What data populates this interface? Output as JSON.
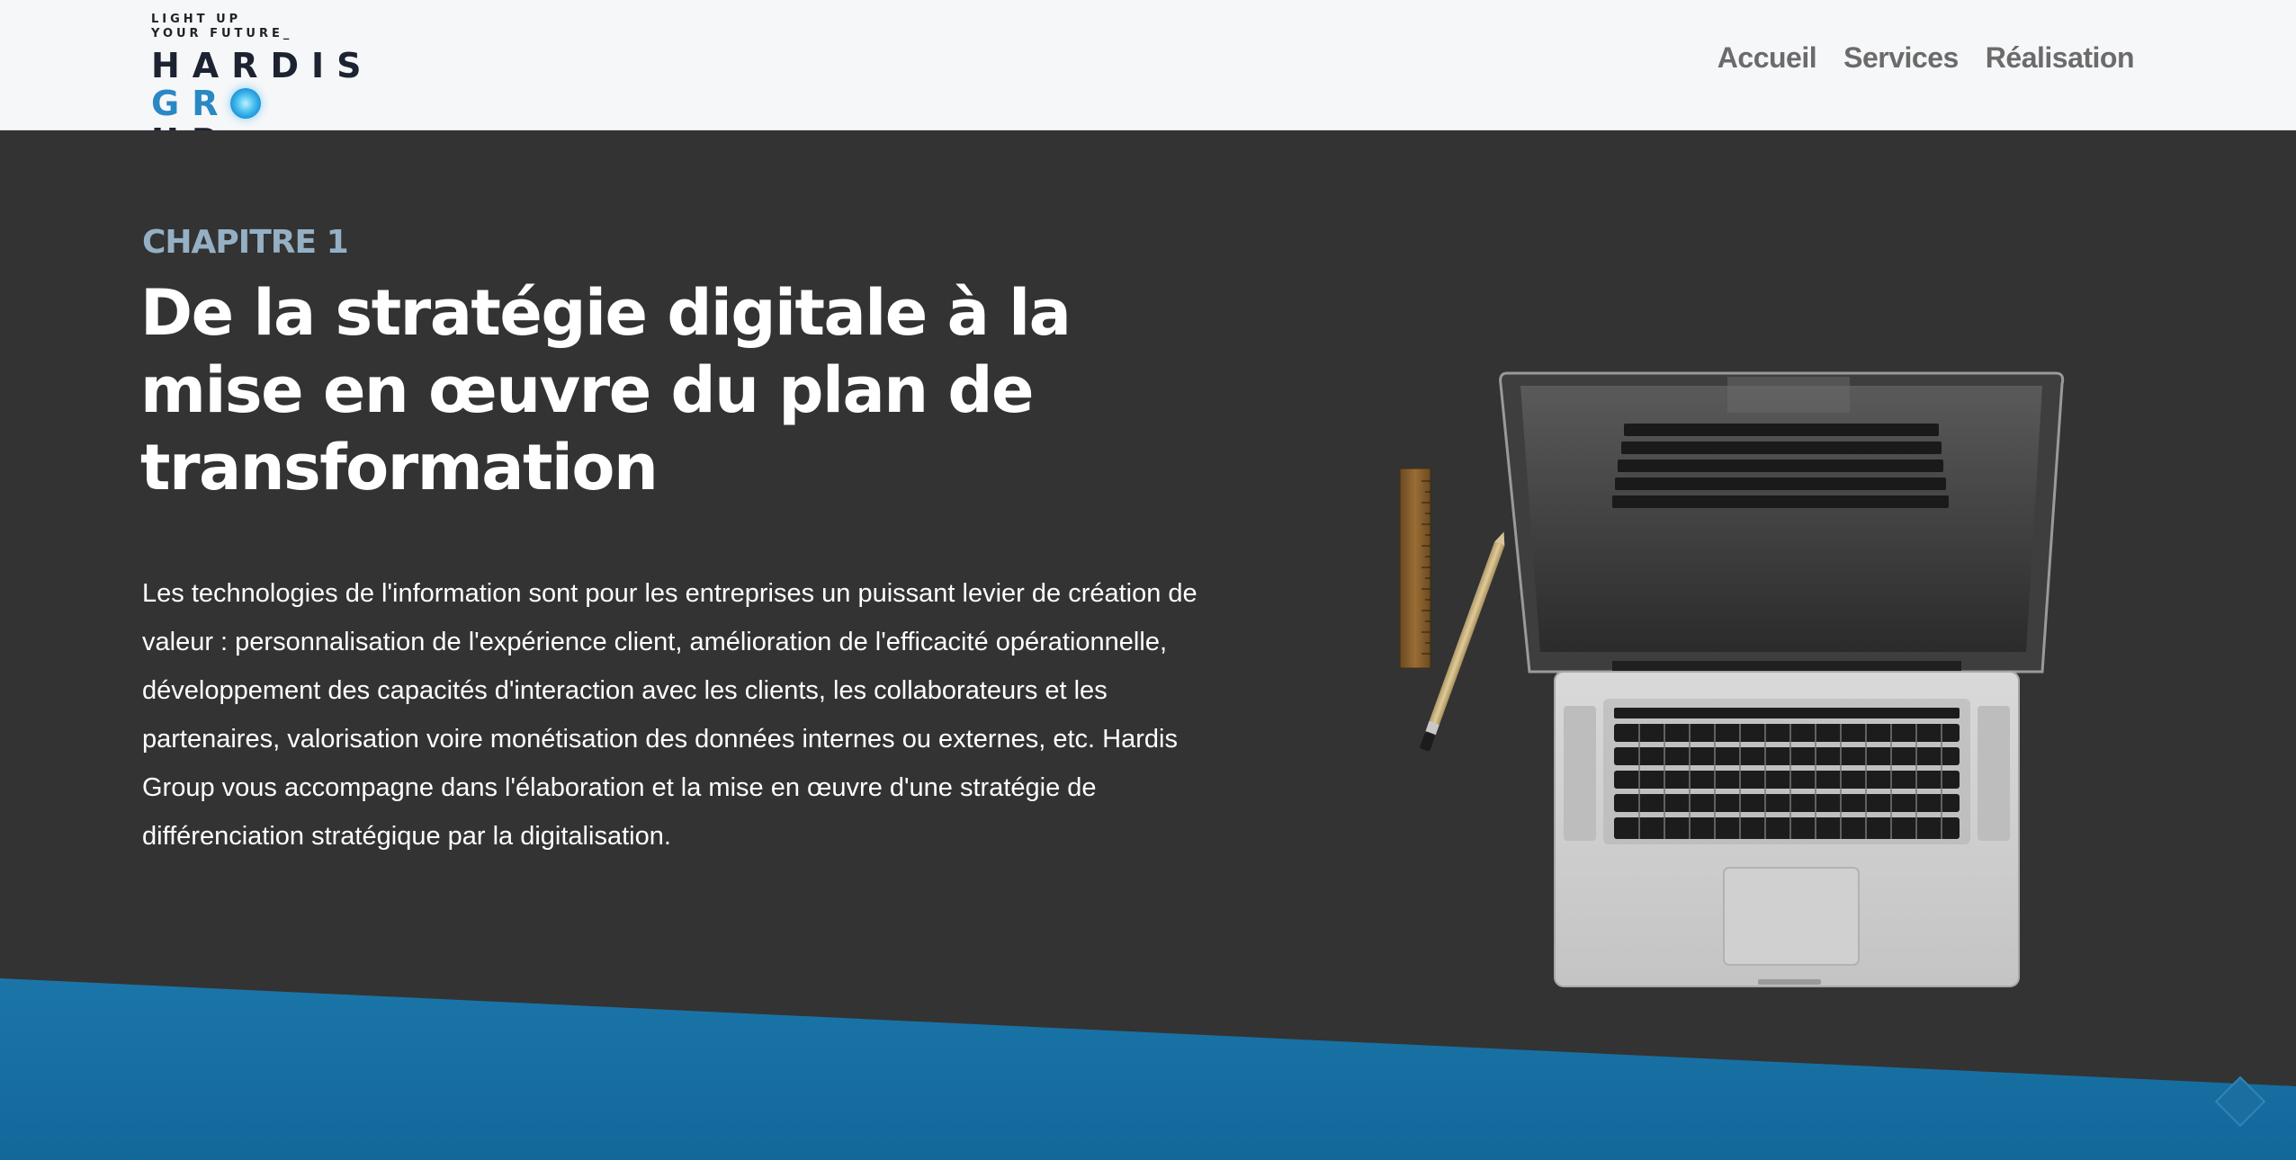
{
  "header": {
    "logo": {
      "tagline_line1": "LIGHT UP",
      "tagline_line2": "YOUR FUTURE_",
      "word1": "HARDIS",
      "word2_before": "GR",
      "word2_after": "UP"
    },
    "nav": [
      {
        "label": "Accueil"
      },
      {
        "label": "Services"
      },
      {
        "label": "Réalisation"
      }
    ]
  },
  "hero": {
    "chapter": "CHAPITRE 1",
    "title": "De la stratégie digitale à la mise en œuvre du plan de transformation",
    "body": "Les technologies de l'information sont pour les entreprises un puissant levier de création de valeur : personnalisation de l'expérience client, amélioration de l'efficacité opérationnelle, développement des capacités d'interaction avec les clients, les collaborateurs et les partenaires, valorisation voire monétisation des données internes ou externes, etc. Hardis Group vous accompagne dans l'élaboration et la mise en œuvre d'une stratégie de différenciation stratégique par la digitalisation."
  },
  "colors": {
    "header_bg": "#f6f7f9",
    "hero_bg": "#333333",
    "chapter": "#95b0c4",
    "band_blue": "#1a6fa0",
    "logo_blue": "#2a88c4"
  },
  "icons": [
    "laptop-illustration",
    "ruler-illustration",
    "pencil-illustration",
    "scroll-badge-icon"
  ]
}
